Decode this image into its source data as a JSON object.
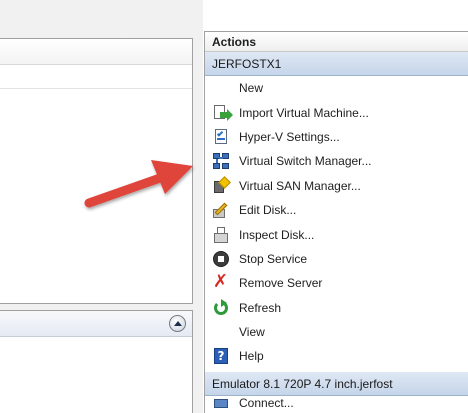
{
  "actions_pane": {
    "title": "Actions",
    "server_section": {
      "header": "JERFOSTX1",
      "items": [
        {
          "label": "New",
          "icon": "none"
        },
        {
          "label": "Import Virtual Machine...",
          "icon": "import-icon"
        },
        {
          "label": "Hyper-V Settings...",
          "icon": "settings-icon"
        },
        {
          "label": "Virtual Switch Manager...",
          "icon": "switch-icon"
        },
        {
          "label": "Virtual SAN Manager...",
          "icon": "san-icon"
        },
        {
          "label": "Edit Disk...",
          "icon": "edit-disk-icon"
        },
        {
          "label": "Inspect Disk...",
          "icon": "inspect-disk-icon"
        },
        {
          "label": "Stop Service",
          "icon": "stop-icon"
        },
        {
          "label": "Remove Server",
          "icon": "remove-icon"
        },
        {
          "label": "Refresh",
          "icon": "refresh-icon"
        },
        {
          "label": "View",
          "icon": "none"
        },
        {
          "label": "Help",
          "icon": "help-icon"
        }
      ]
    },
    "vm_section": {
      "header": "Emulator 8.1 720P 4.7 inch.jerfost",
      "items": [
        {
          "label": "Connect...",
          "icon": "connect-icon"
        }
      ]
    }
  },
  "annotation": {
    "arrow_color": "#e0443a"
  },
  "colors": {
    "section_header": "#c5d5ea",
    "pane_border": "#a0a0a0"
  }
}
